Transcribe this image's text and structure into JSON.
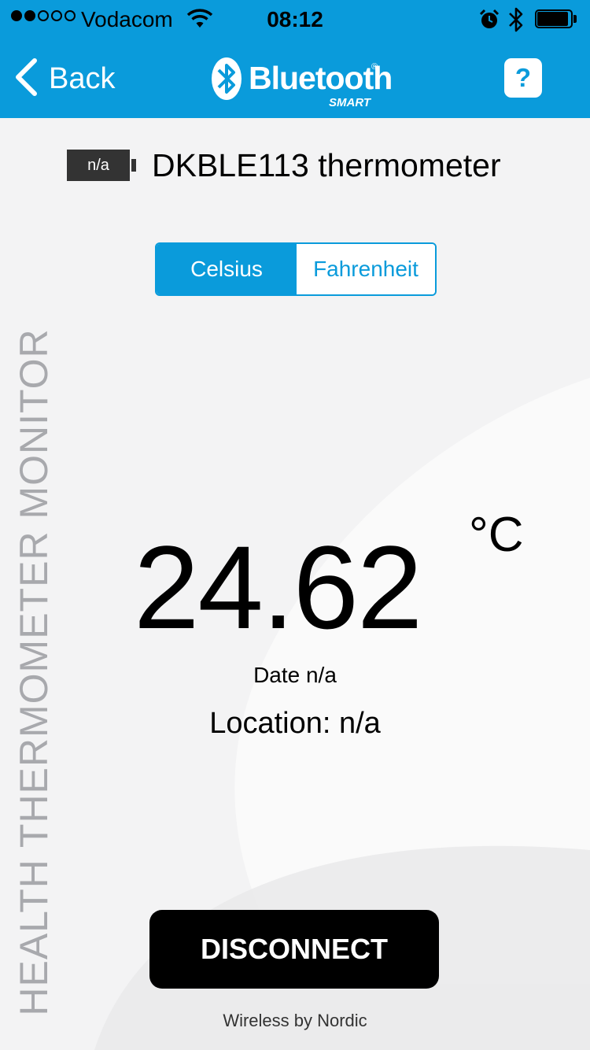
{
  "status_bar": {
    "carrier": "Vodacom",
    "time": "08:12",
    "signal_bars_filled": 2,
    "signal_bars_total": 5,
    "battery_level": 0.92
  },
  "nav": {
    "back_label": "Back",
    "brand_name": "Bluetooth",
    "brand_reg": "®",
    "brand_sub": "SMART",
    "help_label": "?"
  },
  "device": {
    "battery_text": "n/a",
    "name": "DKBLE113 thermometer"
  },
  "side_title": "HEALTH THERMOMETER MONITOR",
  "units": {
    "options": [
      "Celsius",
      "Fahrenheit"
    ],
    "selected": "Celsius"
  },
  "reading": {
    "temperature": "24.62",
    "unit": "°C",
    "date": "Date n/a",
    "location": "Location: n/a"
  },
  "actions": {
    "disconnect_label": "DISCONNECT"
  },
  "footer": "Wireless by Nordic",
  "colors": {
    "accent": "#0a9bdb",
    "background": "#f3f3f4",
    "side_title": "#a8a9ad"
  }
}
